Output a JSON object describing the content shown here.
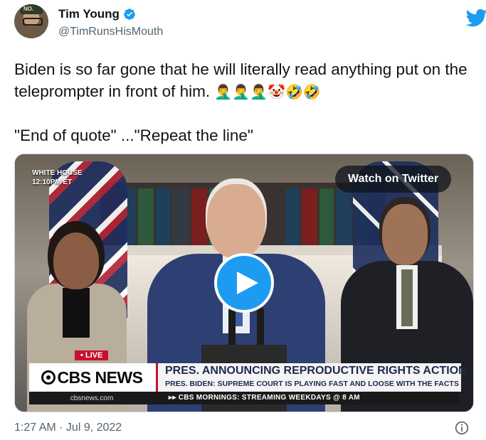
{
  "author": {
    "name": "Tim Young",
    "handle": "@TimRunsHisMouth",
    "avatar_cap_text": "NO."
  },
  "tweet": {
    "line1": "Biden is so far gone that he will literally read anything put on the teleprompter in front of him.",
    "emojis": "🤦‍♂️🤦‍♂️🤦‍♂️🤡🤣🤣",
    "line2": "\"End of quote\" ...\"Repeat the line\""
  },
  "media": {
    "location_badge_line1": "WHITE HOUSE",
    "location_badge_line2": "12:10PM ET",
    "watch_label": "Watch on Twitter",
    "live_label": "• LIVE",
    "network": "CBS NEWS",
    "headline": "PRES. ANNOUNCING REPRODUCTIVE RIGHTS ACTION",
    "subheadline": "PRES. BIDEN: SUPREME COURT IS PLAYING FAST AND LOOSE WITH THE FACTS",
    "ticker_site": "cbsnews.com",
    "ticker_text": "▸▸ CBS MORNINGS: STREAMING WEEKDAYS @ 8 AM"
  },
  "footer": {
    "timestamp": "1:27 AM · Jul 9, 2022"
  },
  "colors": {
    "twitter_blue": "#1d9bf0",
    "text_primary": "#0f1419",
    "text_secondary": "#536471",
    "cbs_red": "#c8102e"
  }
}
